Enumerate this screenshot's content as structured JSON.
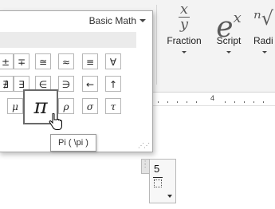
{
  "ribbon": {
    "buttons": [
      {
        "icon": "fraction-x-over-y-icon",
        "label": "Fraction"
      },
      {
        "icon": "script-e-superscript-x-icon",
        "label": "Script"
      },
      {
        "icon": "radical-icon",
        "label": "Radi"
      }
    ],
    "fraction_icon_num": "x",
    "fraction_icon_den": "y",
    "script_icon_base": "e",
    "script_icon_sup": "x",
    "radical_icon_text": "ⁿ√"
  },
  "ruler": {
    "number": "4"
  },
  "gallery": {
    "category": "Basic Math",
    "rows": [
      [
        "±",
        "∓",
        "≅",
        "≈",
        "≡",
        "∀"
      ],
      [
        "∄",
        "∃",
        "∈",
        "∋",
        "←",
        "↑"
      ],
      [
        "μ",
        "π",
        "ρ",
        "σ",
        "τ"
      ]
    ],
    "hovered_symbol": "π",
    "tooltip": "Pi ( \\pi )"
  },
  "equation": {
    "numerator": "5"
  },
  "colors": {
    "ribbon_bg": "#f3f3f3",
    "panel_border": "#a9a9a9",
    "hover_border": "#6a6a6a"
  }
}
